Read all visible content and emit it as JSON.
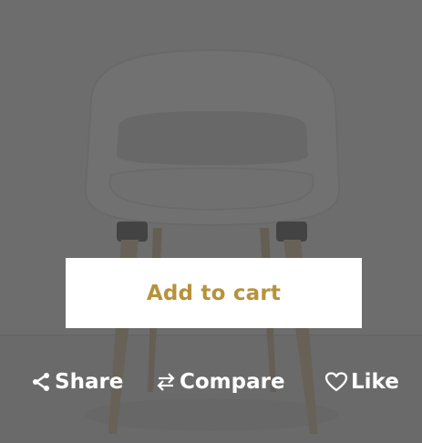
{
  "product": {
    "image_icon": "chair-photo"
  },
  "overlay": {
    "add_to_cart_label": "Add to cart",
    "accent_color": "#b7923a"
  },
  "actions": {
    "share_label": "Share",
    "compare_label": "Compare",
    "like_label": "Like",
    "share_icon": "share-icon",
    "compare_icon": "compare-arrows-icon",
    "like_icon": "heart-icon"
  }
}
